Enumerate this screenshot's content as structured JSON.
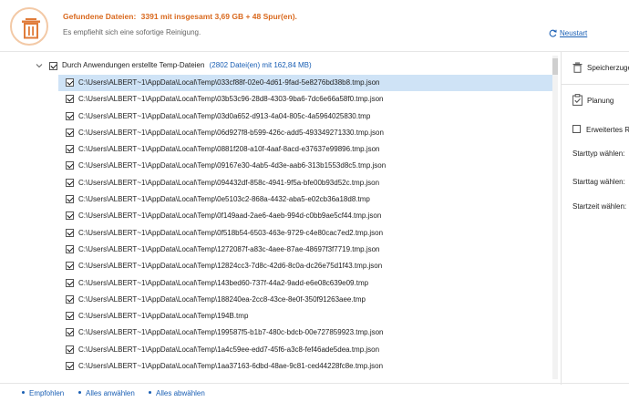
{
  "header": {
    "found_label": "Gefundene Dateien:",
    "found_detail": "3391  mit insgesamt 3,69 GB + 48 Spur(en).",
    "recommendation": "Es empfiehlt sich eine sofortige Reinigung.",
    "restart_label": "Neustart",
    "accent_color": "#d9691e",
    "icon": "trash-icon"
  },
  "group": {
    "label": "Durch Anwendungen erstellte Temp-Dateien",
    "count": "(2802 Datei(en) mit 162,84 MB)",
    "checked": true,
    "expanded": true
  },
  "files": [
    {
      "path": "C:\\Users\\ALBERT~1\\AppData\\Local\\Temp\\033cf88f-02e0-4d61-9fad-5e8276bd38b8.tmp.json",
      "checked": true,
      "selected": true
    },
    {
      "path": "C:\\Users\\ALBERT~1\\AppData\\Local\\Temp\\03b53c96-28d8-4303-9ba6-7dc6e66a58f0.tmp.json",
      "checked": true
    },
    {
      "path": "C:\\Users\\ALBERT~1\\AppData\\Local\\Temp\\03d0a652-d913-4a04-805c-4a5964025830.tmp",
      "checked": true
    },
    {
      "path": "C:\\Users\\ALBERT~1\\AppData\\Local\\Temp\\06d927f8-b599-426c-add5-493349271330.tmp.json",
      "checked": true
    },
    {
      "path": "C:\\Users\\ALBERT~1\\AppData\\Local\\Temp\\0881f208-a10f-4aaf-8acd-e37637e99896.tmp.json",
      "checked": true
    },
    {
      "path": "C:\\Users\\ALBERT~1\\AppData\\Local\\Temp\\09167e30-4ab5-4d3e-aab6-313b1553d8c5.tmp.json",
      "checked": true
    },
    {
      "path": "C:\\Users\\ALBERT~1\\AppData\\Local\\Temp\\094432df-858c-4941-9f5a-bfe00b93d52c.tmp.json",
      "checked": true
    },
    {
      "path": "C:\\Users\\ALBERT~1\\AppData\\Local\\Temp\\0e5103c2-868a-4432-aba5-e02cb36a18d8.tmp",
      "checked": true
    },
    {
      "path": "C:\\Users\\ALBERT~1\\AppData\\Local\\Temp\\0f149aad-2ae6-4aeb-994d-c0bb9ae5cf44.tmp.json",
      "checked": true
    },
    {
      "path": "C:\\Users\\ALBERT~1\\AppData\\Local\\Temp\\0f518b54-6503-463e-9729-c4e80cac7ed2.tmp.json",
      "checked": true
    },
    {
      "path": "C:\\Users\\ALBERT~1\\AppData\\Local\\Temp\\1272087f-a83c-4aee-87ae-48697f3f7719.tmp.json",
      "checked": true
    },
    {
      "path": "C:\\Users\\ALBERT~1\\AppData\\Local\\Temp\\12824cc3-7d8c-42d6-8c0a-dc26e75d1f43.tmp.json",
      "checked": true
    },
    {
      "path": "C:\\Users\\ALBERT~1\\AppData\\Local\\Temp\\143bed60-737f-44a2-9add-e6e08c639e09.tmp",
      "checked": true
    },
    {
      "path": "C:\\Users\\ALBERT~1\\AppData\\Local\\Temp\\188240ea-2cc8-43ce-8e0f-350f91263aee.tmp",
      "checked": true
    },
    {
      "path": "C:\\Users\\ALBERT~1\\AppData\\Local\\Temp\\194B.tmp",
      "checked": true
    },
    {
      "path": "C:\\Users\\ALBERT~1\\AppData\\Local\\Temp\\199587f5-b1b7-480c-bdcb-00e727859923.tmp.json",
      "checked": true
    },
    {
      "path": "C:\\Users\\ALBERT~1\\AppData\\Local\\Temp\\1a4c59ee-edd7-45f6-a3c8-fef46ade5dea.tmp.json",
      "checked": true
    },
    {
      "path": "C:\\Users\\ALBERT~1\\AppData\\Local\\Temp\\1aa37163-6dbd-48ae-9c81-ced44228fc8e.tmp.json",
      "checked": true
    }
  ],
  "right_panel": {
    "storage_label": "Speicherzuge",
    "schedule_label": "Planung",
    "advanced_label": "Erweitertes Re",
    "start_type_label": "Starttyp wählen:",
    "start_day_label": "Starttag wählen:",
    "start_time_label": "Startzeit wählen:"
  },
  "footer": {
    "recommended": "Empfohlen",
    "select_all": "Alles anwählen",
    "deselect_all": "Alles abwählen"
  }
}
